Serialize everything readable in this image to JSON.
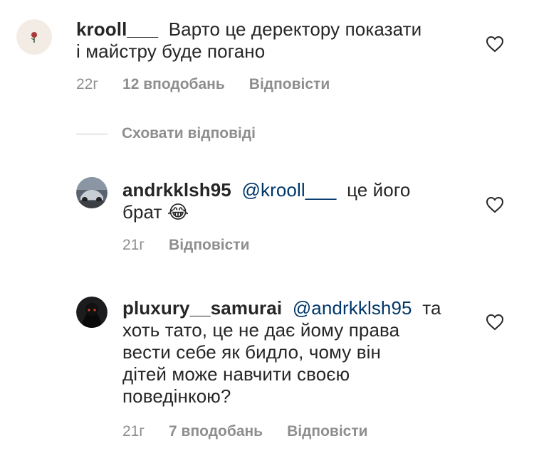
{
  "comments": [
    {
      "username": "krooll___",
      "text": "Варто це деректору показати",
      "text_line2": "і майстру буде погано",
      "time": "22г",
      "likes": "12 вподобань",
      "reply": "Відповісти"
    },
    {
      "username": "andrkklsh95",
      "mention": "@krooll___",
      "text": "це його",
      "text_line2": "брат 😂",
      "time": "21г",
      "reply": "Відповісти"
    },
    {
      "username": "pluxury__samurai",
      "mention": "@andrkklsh95",
      "text": "та",
      "lines": [
        "хоть тато, це не дає йому права",
        "вести себе як бидло, чому він",
        "дітей може навчити своєю",
        "поведінкою?"
      ],
      "time": "21г",
      "likes": "7 вподобань",
      "reply": "Відповісти"
    }
  ],
  "hide_replies": "Сховати відповіді",
  "colors": {
    "text": "#262626",
    "meta": "#8e8e8e",
    "mention": "#00376b"
  },
  "icons": [
    "heart-icon",
    "avatar"
  ]
}
